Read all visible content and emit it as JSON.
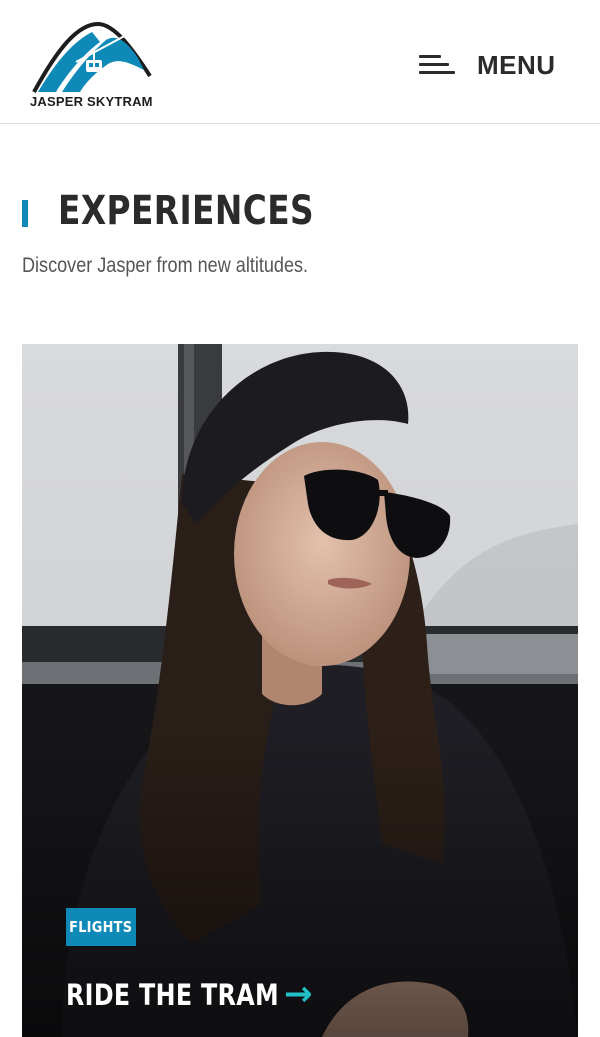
{
  "header": {
    "logo_text": "JASPER SKYTRAM",
    "menu_label": "MENU"
  },
  "section": {
    "title": "EXPERIENCES",
    "subtitle": "Discover Jasper from new altitudes."
  },
  "card": {
    "badge": "FLIGHTS",
    "title": "RIDE THE TRAM",
    "arrow": "→"
  },
  "colors": {
    "accent_blue": "#0f8ab8",
    "accent_teal": "#21c0c9",
    "text_dark": "#2b2b2b"
  }
}
